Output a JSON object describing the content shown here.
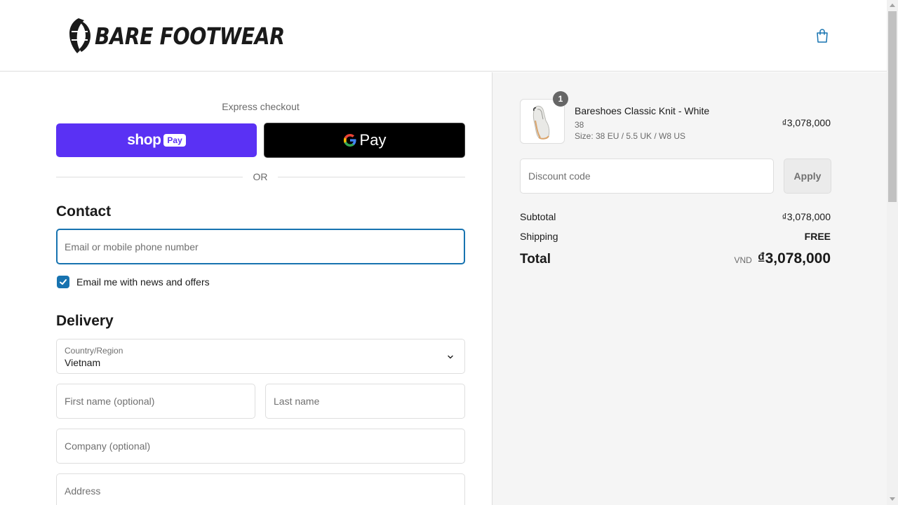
{
  "header": {
    "brand": "BARE FOOTWEAR",
    "logo_icon": "leaf-shield-logo",
    "cart_icon": "shopping-bag-icon"
  },
  "express": {
    "label": "Express checkout",
    "shop_pay": {
      "word": "shop",
      "pill": "Pay"
    },
    "gpay": {
      "word": "Pay"
    },
    "or_label": "OR"
  },
  "contact": {
    "title": "Contact",
    "email_placeholder": "Email or mobile phone number",
    "newsletter_label": "Email me with news and offers",
    "newsletter_checked": true
  },
  "delivery": {
    "title": "Delivery",
    "country_label": "Country/Region",
    "country_value": "Vietnam",
    "first_name_placeholder": "First name (optional)",
    "last_name_placeholder": "Last name",
    "company_placeholder": "Company (optional)",
    "address_placeholder": "Address"
  },
  "order": {
    "item": {
      "quantity": "1",
      "name": "Bareshoes Classic Knit - White",
      "variant": "38",
      "size": "Size: 38 EU / 5.5 UK / W8 US",
      "price": "₫3,078,000"
    },
    "discount_placeholder": "Discount code",
    "apply_label": "Apply",
    "subtotal_label": "Subtotal",
    "subtotal_value": "₫3,078,000",
    "shipping_label": "Shipping",
    "shipping_value": "FREE",
    "total_label": "Total",
    "total_currency": "VND",
    "total_value": "₫3,078,000"
  },
  "colors": {
    "shop_pay": "#5a31f4",
    "accent": "#1773b0",
    "summary_bg": "#f5f5f5"
  }
}
